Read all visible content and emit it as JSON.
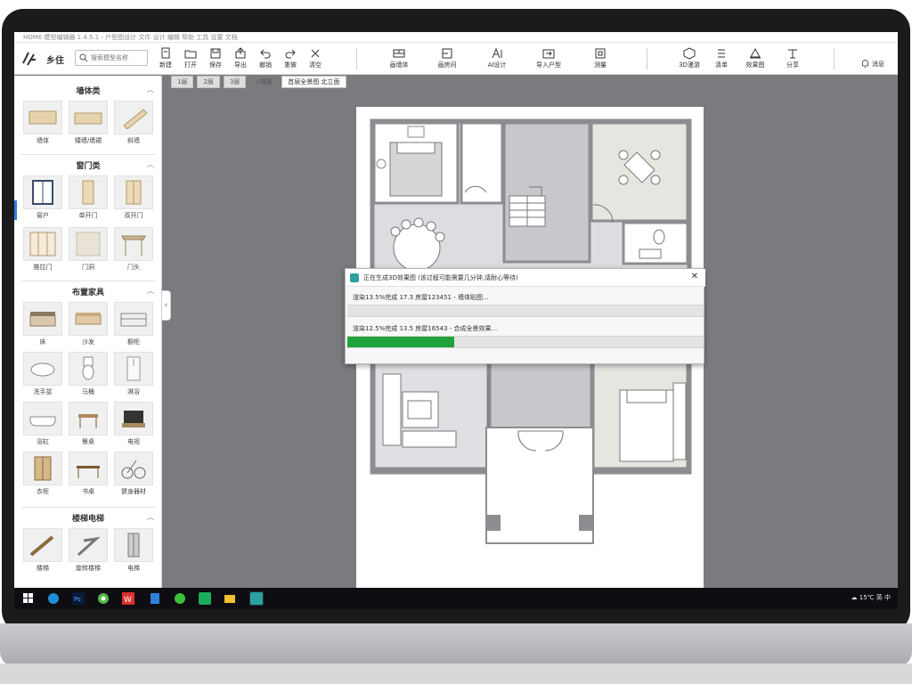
{
  "window": {
    "title": "HOME 模型编辑器 1.4.5.1 - 户型图设计 文件 设计 编辑 帮助 工具 设置 文档"
  },
  "toolbar": {
    "app_name": "乡住",
    "search_placeholder": "搜索模型名称",
    "buttons": [
      {
        "label": "新建",
        "icon": "file-new-icon"
      },
      {
        "label": "打开",
        "icon": "folder-open-icon"
      },
      {
        "label": "保存",
        "icon": "save-icon"
      },
      {
        "label": "导出",
        "icon": "export-icon"
      },
      {
        "label": "撤销",
        "icon": "undo-icon"
      },
      {
        "label": "重做",
        "icon": "redo-icon"
      },
      {
        "label": "清空",
        "icon": "clear-icon"
      }
    ],
    "buttons2": [
      {
        "label": "画墙体",
        "icon": "wall-icon"
      },
      {
        "label": "画房间",
        "icon": "room-icon"
      },
      {
        "label": "AI设计",
        "icon": "ai-design-icon"
      },
      {
        "label": "导入户型",
        "icon": "import-icon"
      },
      {
        "label": "测量",
        "icon": "measure-icon"
      }
    ],
    "buttons3": [
      {
        "label": "3D漫游",
        "icon": "3d-icon"
      },
      {
        "label": "清单",
        "icon": "list-icon"
      },
      {
        "label": "效果图",
        "icon": "render-icon"
      },
      {
        "label": "分享",
        "icon": "share-icon"
      }
    ],
    "user_label": "消息"
  },
  "sidebar": {
    "sections": [
      {
        "title": "墙体类",
        "items": [
          {
            "label": "墙体",
            "icon": "wall-block-icon"
          },
          {
            "label": "矮墙/墙裙",
            "icon": "low-wall-icon"
          },
          {
            "label": "斜墙",
            "icon": "slant-wall-icon"
          }
        ]
      },
      {
        "title": "窗门类",
        "items": [
          {
            "label": "窗户",
            "icon": "window-icon"
          },
          {
            "label": "单开门",
            "icon": "single-door-icon"
          },
          {
            "label": "双开门",
            "icon": "double-door-icon"
          },
          {
            "label": "推拉门",
            "icon": "sliding-door-icon"
          },
          {
            "label": "门洞",
            "icon": "door-opening-icon"
          },
          {
            "label": "门头",
            "icon": "door-head-icon"
          }
        ]
      },
      {
        "title": "布置家具",
        "items": [
          {
            "label": "床",
            "icon": "bed-icon"
          },
          {
            "label": "沙发",
            "icon": "sofa-icon"
          },
          {
            "label": "橱柜",
            "icon": "cabinet-icon"
          },
          {
            "label": "洗手盆",
            "icon": "basin-icon"
          },
          {
            "label": "马桶",
            "icon": "toilet-icon"
          },
          {
            "label": "淋浴",
            "icon": "shower-icon"
          },
          {
            "label": "浴缸",
            "icon": "bathtub-icon"
          },
          {
            "label": "餐桌",
            "icon": "dining-table-icon"
          },
          {
            "label": "电视",
            "icon": "tv-icon"
          },
          {
            "label": "衣柜",
            "icon": "wardrobe-icon"
          },
          {
            "label": "书桌",
            "icon": "desk-icon"
          },
          {
            "label": "健身器材",
            "icon": "fitness-icon"
          }
        ]
      },
      {
        "title": "楼梯电梯",
        "items": [
          {
            "label": "楼梯",
            "icon": "stair-icon"
          },
          {
            "label": "旋转楼梯",
            "icon": "spiral-stair-icon"
          },
          {
            "label": "电梯",
            "icon": "elevator-icon"
          }
        ]
      }
    ]
  },
  "floor_tabs": [
    {
      "label": "1层",
      "active": false
    },
    {
      "label": "2层",
      "active": false
    },
    {
      "label": "3层",
      "active": false
    },
    {
      "label": "+楼层",
      "active": false
    },
    {
      "label": "首层全景图 北立面",
      "active": true
    }
  ],
  "dialog": {
    "title": "正在生成3D效果图 (该过程可能需要几分钟,请耐心等待)",
    "line1": "渲染13.5%完成 17.3 房屋123451 - 墙体贴图...",
    "line2": "渲染12.5%完成 13.5 房屋16543 - 合成全景效果...",
    "progress1": 0,
    "progress2": 0.3
  },
  "taskbar": {
    "apps": [
      "windows-start-icon",
      "edge-icon",
      "photoshop-icon",
      "chrome-icon",
      "wps-icon",
      "files-icon",
      "browser-icon",
      "wechat-icon",
      "folder-icon",
      "app-icon"
    ],
    "tray_text": "15℃ 英 中"
  }
}
